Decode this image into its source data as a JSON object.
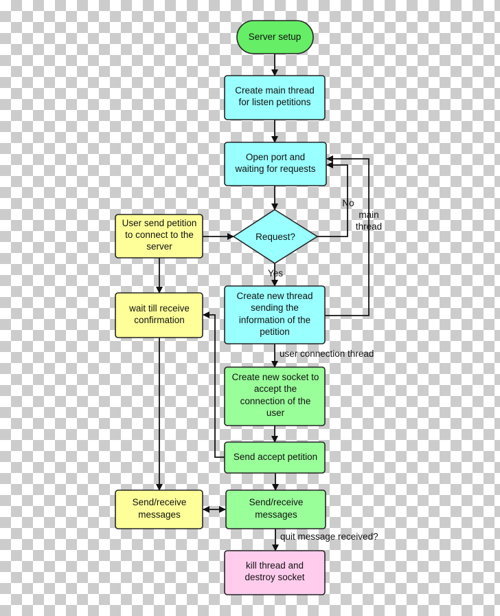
{
  "colors": {
    "start": "#66ee66",
    "process_cyan": "#99ffff",
    "user_yellow": "#ffff99",
    "thread_green": "#99ff99",
    "end_pink": "#ffccee"
  },
  "nodes": {
    "server_setup": [
      "Server setup"
    ],
    "create_main_thread": [
      "Create main thread",
      "for listen petitions"
    ],
    "open_port": [
      "Open port and",
      "waiting for requests"
    ],
    "request": [
      "Request?"
    ],
    "user_send_petition": [
      "User send petition",
      "to connect to the",
      "server"
    ],
    "create_new_thread": [
      "Create new thread",
      "sending the",
      "information of the",
      "petition"
    ],
    "wait_confirmation": [
      "wait till receive",
      "confirmation"
    ],
    "create_socket": [
      "Create new socket to",
      "accept the",
      "connection of the",
      "user"
    ],
    "send_accept": [
      "Send accept petition"
    ],
    "user_send_receive": [
      "Send/receive",
      "messages"
    ],
    "server_send_receive": [
      "Send/receive",
      "messages"
    ],
    "kill_thread": [
      "kill thread and",
      "destroy socket"
    ]
  },
  "edge_labels": {
    "no": "No",
    "yes": "Yes",
    "main_thread": [
      "main",
      "thread"
    ],
    "user_connection_thread": "user connection thread",
    "quit_message": "quit message received?"
  }
}
